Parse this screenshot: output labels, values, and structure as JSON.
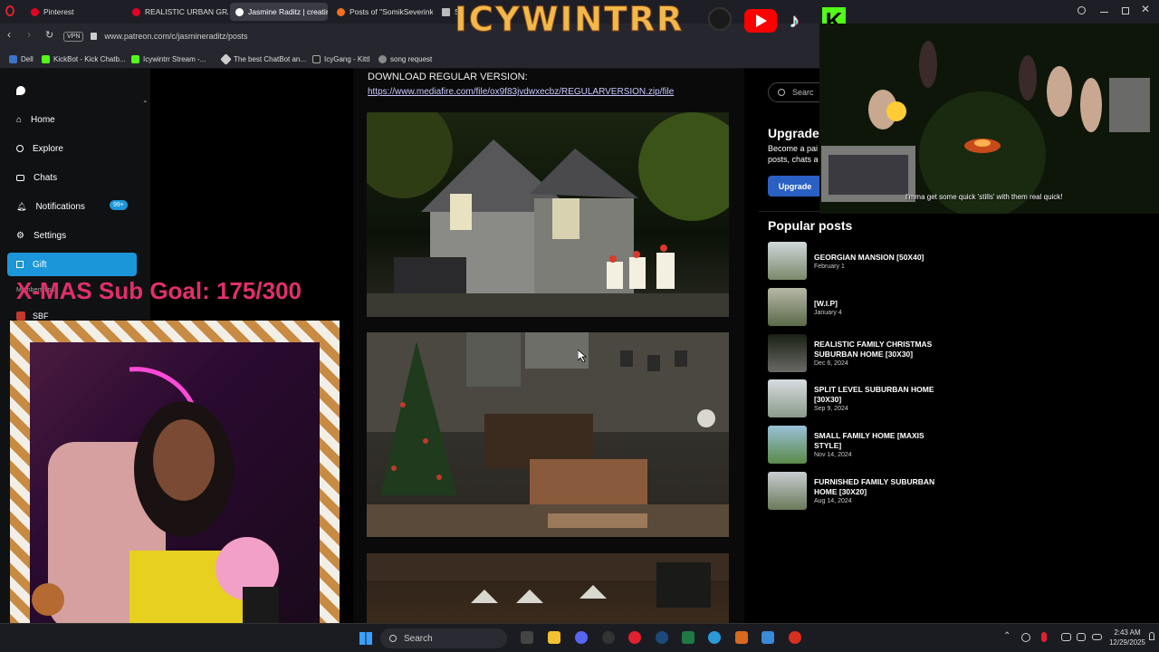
{
  "tabs": [
    {
      "label": "Pinterest",
      "color": "#e60023"
    },
    {
      "label": "REALISTIC URBAN GRAND",
      "color": "#e60023"
    },
    {
      "label": "Jasmine Raditz | creating",
      "color": "#ffffff"
    },
    {
      "label": "Posts of \"SomikSeverinka\"",
      "color": "#f07020"
    },
    {
      "label": "Se",
      "color": "#cccccc"
    }
  ],
  "address": {
    "vpn": "VPN",
    "url": "www.patreon.com/c/jasmineraditz/posts"
  },
  "bookmarks": [
    {
      "label": "Dell",
      "color": "#3b73c8"
    },
    {
      "label": "KickBot - Kick Chatb...",
      "color": "#53fc18"
    },
    {
      "label": "Icywintrr Stream -...",
      "color": "#53fc18"
    },
    {
      "label": "The best ChatBot an...",
      "color": "#cccccc"
    },
    {
      "label": "IcyGang - Kittl",
      "color": "#222222"
    },
    {
      "label": "song request",
      "color": "#8a8a8a"
    }
  ],
  "stream": {
    "channel_name": "ICYWINTRR",
    "sub_goal": "X-MAS Sub Goal: 175/300",
    "caption": "I'mma get some quick 'stills' with them real quick!"
  },
  "sidebar": {
    "items": [
      {
        "label": "Home",
        "icon": "home-icon"
      },
      {
        "label": "Explore",
        "icon": "search-icon"
      },
      {
        "label": "Chats",
        "icon": "chat-icon"
      },
      {
        "label": "Notifications",
        "icon": "bell-icon",
        "badge": "99+"
      },
      {
        "label": "Settings",
        "icon": "gear-icon"
      },
      {
        "label": "Gift",
        "icon": "gift-icon"
      }
    ],
    "memberships_label": "Memberships",
    "member_item": "SBF"
  },
  "post": {
    "download_heading": "DOWNLOAD REGULAR VERSION:",
    "download_link": "https://www.mediafire.com/file/ox9f83jvdwxecbz/REGULARVERSION.zip/file"
  },
  "right": {
    "search_placeholder": "Searc",
    "upgrade_title": "Upgrade",
    "upgrade_text_1": "Become a pai",
    "upgrade_text_2": "posts, chats a",
    "upgrade_button": "Upgrade",
    "popular_heading": "Popular posts",
    "popular_posts": [
      {
        "title": "GEORGIAN MANSION [50X40]",
        "date": "February 1"
      },
      {
        "title": "[W.I.P]",
        "date": "January 4"
      },
      {
        "title": "REALISTIC FAMILY CHRISTMAS SUBURBAN HOME [30X30]",
        "date": "Dec 6, 2024"
      },
      {
        "title": "SPLIT LEVEL SUBURBAN HOME [30X30]",
        "date": "Sep 9, 2024"
      },
      {
        "title": "SMALL FAMILY HOME [MAXIS STYLE]",
        "date": "Nov 14, 2024"
      },
      {
        "title": "FURNISHED FAMILY SUBURBAN HOME [30X20]",
        "date": "Aug 14, 2024"
      }
    ]
  },
  "taskbar": {
    "search_placeholder": "Search",
    "time": "2:43 AM",
    "date": "12/29/2025"
  }
}
